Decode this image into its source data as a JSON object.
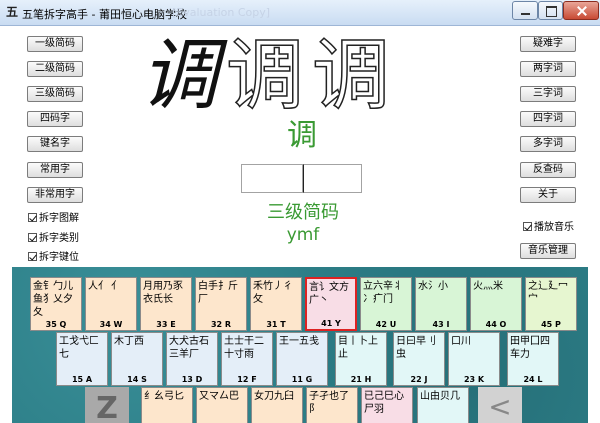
{
  "window": {
    "icon_char": "五",
    "title": "五笔拆字高手 - 莆田恒心电脑学校",
    "title_ghost": "[Evaluation Copy]"
  },
  "left_buttons": [
    "一级简码",
    "二级简码",
    "三级简码",
    "四码字",
    "键名字",
    "常用字",
    "非常用字"
  ],
  "right_buttons": [
    "疑难字",
    "两字词",
    "三字词",
    "四字词",
    "多字词",
    "反查码",
    "关于"
  ],
  "display": {
    "big_char": "调",
    "green_char": "调",
    "input_value": "",
    "level_text": "三级简码",
    "code_text": "ymf"
  },
  "checkboxes": [
    {
      "label": "拆字图解",
      "checked": true
    },
    {
      "label": "拆字类别",
      "checked": true
    },
    {
      "label": "拆字键位",
      "checked": true
    }
  ],
  "music": {
    "checkbox_label": "播放音乐",
    "checked": true,
    "button_label": "音乐管理"
  },
  "keyboard": {
    "row1": [
      {
        "roots": "金钅勹儿鱼犭乂夕夂",
        "label": "35 Q",
        "color": "orange"
      },
      {
        "roots": "人亻 亻",
        "label": "34 W",
        "color": "orange"
      },
      {
        "roots": "月用乃豕衣氏长",
        "label": "33 E",
        "color": "orange"
      },
      {
        "roots": "白手扌斤厂",
        "label": "32 R",
        "color": "orange"
      },
      {
        "roots": "禾竹丿彳攵",
        "label": "31 T",
        "color": "orange"
      },
      {
        "roots": "言讠文方广丶",
        "label": "41 Y",
        "color": "pink"
      },
      {
        "roots": "立六辛丬冫疒门",
        "label": "42 U",
        "color": "green"
      },
      {
        "roots": "水氵小",
        "label": "43 I",
        "color": "green"
      },
      {
        "roots": "火灬米",
        "label": "44 O",
        "color": "green"
      },
      {
        "roots": "之辶廴冖宀",
        "label": "45 P",
        "color": "lightgreen"
      }
    ],
    "row2": [
      {
        "roots": "工戈弋匚七",
        "label": "15 A",
        "color": "blue"
      },
      {
        "roots": "木丁西",
        "label": "14 S",
        "color": "blue"
      },
      {
        "roots": "大犬古石三羊厂",
        "label": "13 D",
        "color": "blue"
      },
      {
        "roots": "土士干二十寸雨",
        "label": "12 F",
        "color": "blue"
      },
      {
        "roots": "王一五戋",
        "label": "11 G",
        "color": "blue"
      },
      {
        "roots": "目丨卜上止",
        "label": "21 H",
        "color": "cyan"
      },
      {
        "roots": "日曰早刂虫",
        "label": "22 J",
        "color": "cyan"
      },
      {
        "roots": "口川",
        "label": "23 K",
        "color": "cyan"
      },
      {
        "roots": "田甲囗四车力",
        "label": "24 L",
        "color": "cyan"
      }
    ],
    "row3": [
      {
        "roots": "纟幺弓匕",
        "label": "",
        "color": "orange"
      },
      {
        "roots": "又マ厶巴",
        "label": "",
        "color": "orange"
      },
      {
        "roots": "女刀九臼",
        "label": "",
        "color": "orange"
      },
      {
        "roots": "子孑也了阝",
        "label": "",
        "color": "orange"
      },
      {
        "roots": "已己巳心尸羽",
        "label": "",
        "color": "pink"
      },
      {
        "roots": "山由贝几",
        "label": "",
        "color": "cyan"
      }
    ],
    "z_key": "Z",
    "back_key": "<"
  }
}
